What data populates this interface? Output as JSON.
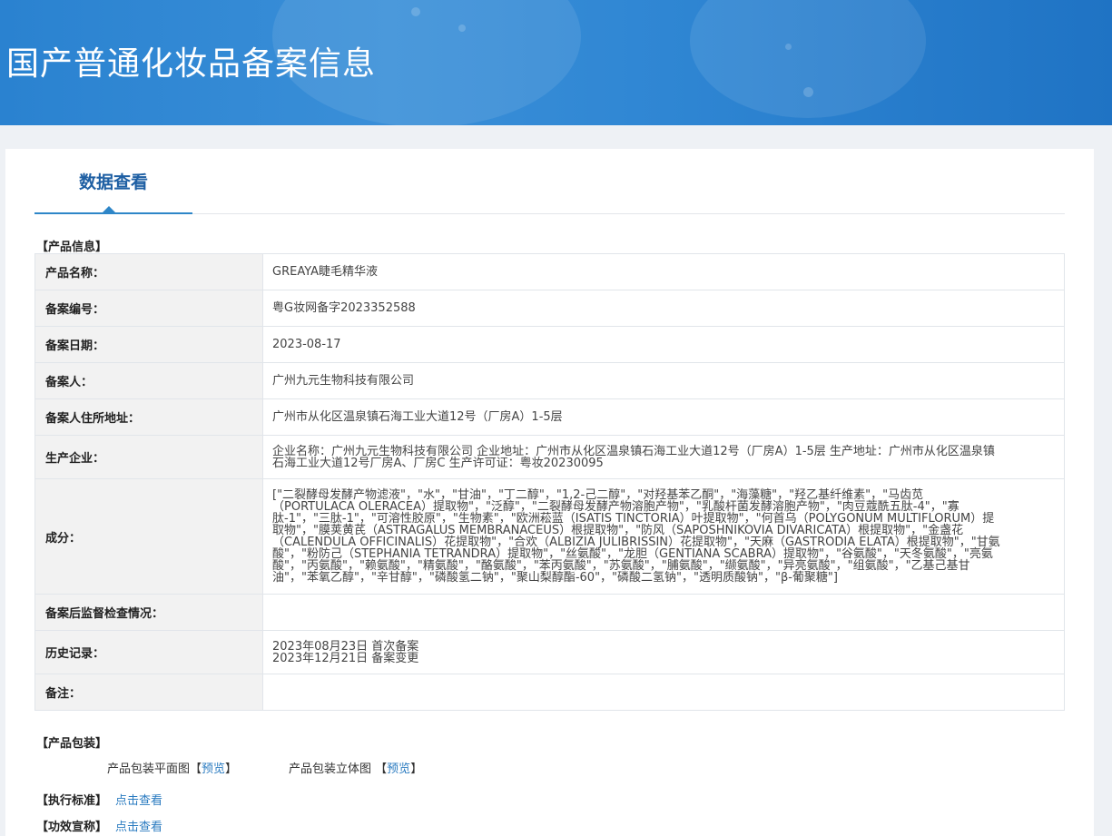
{
  "banner": {
    "title": "国产普通化妆品备案信息"
  },
  "tab": {
    "label": "数据查看"
  },
  "product_info": {
    "heading": "【产品信息】",
    "rows": [
      {
        "label": "产品名称：",
        "value": [
          "GREAYA睫毛精华液"
        ]
      },
      {
        "label": "备案编号：",
        "value": [
          "粤G妆网备字2023352588"
        ]
      },
      {
        "label": "备案日期：",
        "value": [
          "2023-08-17"
        ]
      },
      {
        "label": "备案人：",
        "value": [
          "广州九元生物科技有限公司"
        ]
      },
      {
        "label": "备案人住所地址：",
        "value": [
          "广州市从化区温泉镇石海工业大道12号（厂房A）1-5层"
        ]
      },
      {
        "label": "生产企业：",
        "value": [
          "企业名称：广州九元生物科技有限公司 企业地址：广州市从化区温泉镇石海工业大道12号（厂房A）1-5层 生产地址：广州市从化区温泉镇",
          "石海工业大道12号厂房A、厂房C 生产许可证：粤妆20230095"
        ]
      },
      {
        "label": "成分：",
        "value": [
          "[\"二裂酵母发酵产物滤液\"，\"水\"，\"甘油\"，\"丁二醇\"，\"1,2-己二醇\"，\"对羟基苯乙酮\"，\"海藻糖\"，\"羟乙基纤维素\"，\"马齿苋",
          "（PORTULACA OLERACEA）提取物\"，\"泛醇\"，\"二裂酵母发酵产物溶胞产物\"，\"乳酸杆菌发酵溶胞产物\"，\"肉豆蔻酰五肽-4\"，\"寡",
          "肽-1\"，\"三肽-1\"，\"可溶性胶原\"，\"生物素\"，\"欧洲菘蓝（ISATIS TINCTORIA）叶提取物\"，\"何首乌（POLYGONUM MULTIFLORUM）提",
          "取物\"，\"膜荚黄芪（ASTRAGALUS MEMBRANACEUS）根提取物\"，\"防风（SAPOSHNIKOVIA DIVARICATA）根提取物\"，\"金盏花",
          "（CALENDULA OFFICINALIS）花提取物\"，\"合欢（ALBIZIA JULIBRISSIN）花提取物\"，\"天麻（GASTRODIA ELATA）根提取物\"，\"甘氨",
          "酸\"，\"粉防己（STEPHANIA TETRANDRA）提取物\"，\"丝氨酸\"，\"龙胆（GENTIANA SCABRA）提取物\"，\"谷氨酸\"，\"天冬氨酸\"，\"亮氨",
          "酸\"，\"丙氨酸\"，\"赖氨酸\"，\"精氨酸\"，\"酪氨酸\"，\"苯丙氨酸\"，\"苏氨酸\"，\"脯氨酸\"，\"缬氨酸\"，\"异亮氨酸\"，\"组氨酸\"，\"乙基己基甘",
          "油\"，\"苯氧乙醇\"，\"辛甘醇\"，\"磷酸氢二钠\"，\"聚山梨醇酯-60\"，\"磷酸二氢钠\"，\"透明质酸钠\"，\"β-葡聚糖\"]"
        ]
      },
      {
        "label": "备案后监督检查情况：",
        "value": []
      },
      {
        "label": "历史记录：",
        "value": [
          "2023年08月23日 首次备案",
          "2023年12月21日 备案变更"
        ]
      },
      {
        "label": "备注：",
        "value": []
      }
    ]
  },
  "packaging": {
    "heading": "【产品包装】",
    "flat_label": "产品包装平面图",
    "solid_label": "产品包装立体图",
    "bracket_open": "【",
    "bracket_close": "】",
    "preview_link": "预览"
  },
  "standard": {
    "heading": "【执行标准】",
    "link": "点击查看"
  },
  "efficacy": {
    "heading": "【功效宣称】",
    "link": "点击查看"
  },
  "colors": {
    "banner": "#2f86d3",
    "accent": "#2e86c8",
    "link": "#2a7bc0"
  }
}
